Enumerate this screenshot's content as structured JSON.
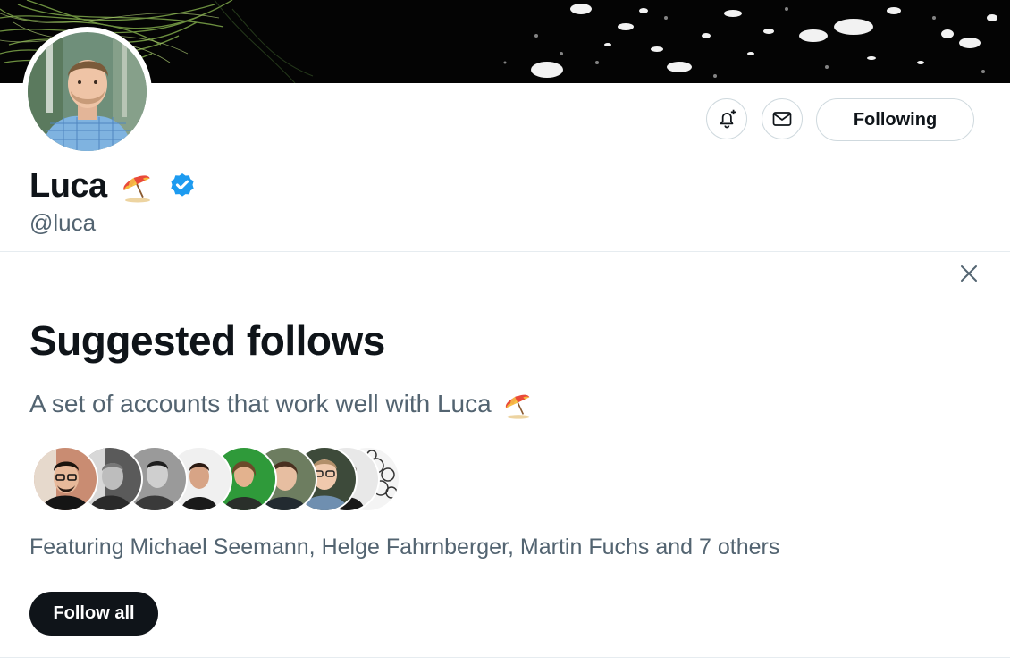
{
  "profile": {
    "display_name": "Luca",
    "handle": "@luca",
    "name_emoji": "umbrella-on-ground-icon",
    "verified": true,
    "verified_color": "#1d9bf0"
  },
  "actions": {
    "notify_icon": "bell-plus-icon",
    "message_icon": "envelope-icon",
    "following_label": "Following"
  },
  "suggested": {
    "title": "Suggested follows",
    "description": "A set of accounts that work well with Luca",
    "description_emoji": "umbrella-on-ground-icon",
    "featuring": "Featuring Michael Seemann, Helge Fahrnberger, Martin Fuchs and 7 others",
    "follow_all_label": "Follow all",
    "close_icon": "close-icon"
  },
  "colors": {
    "text_primary": "#0f1419",
    "text_secondary": "#536471",
    "border": "#cfd9de",
    "button_dark": "#0f1419"
  }
}
